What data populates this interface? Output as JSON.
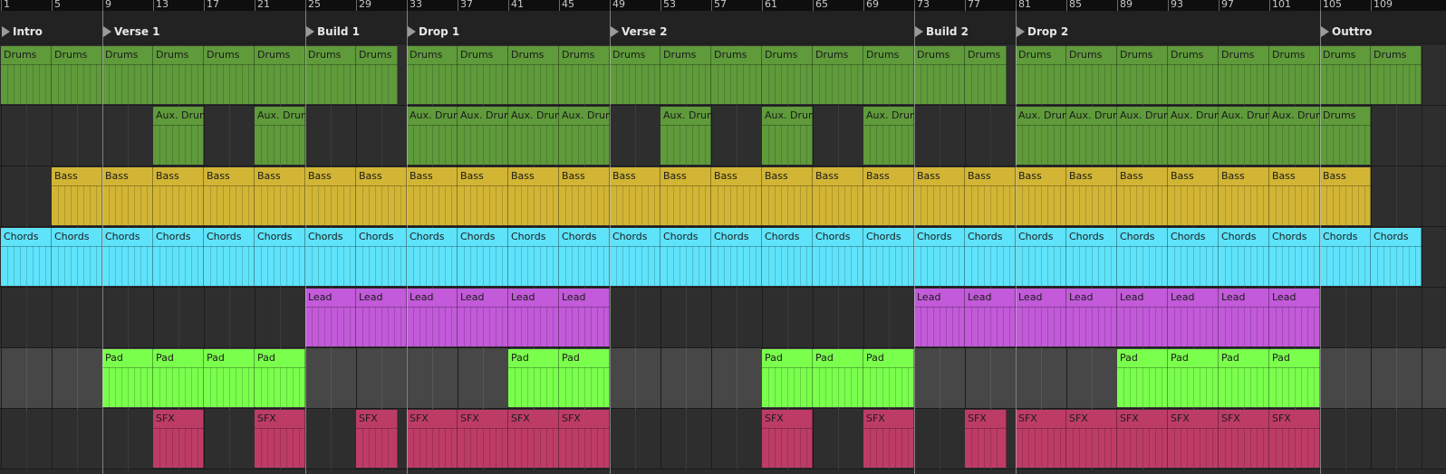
{
  "ruler": {
    "bar_numbers": [
      "1",
      "5",
      "9",
      "13",
      "17",
      "21",
      "25",
      "29",
      "33",
      "37",
      "41",
      "45",
      "49",
      "53",
      "57",
      "61",
      "65",
      "69",
      "73",
      "77",
      "81",
      "85",
      "89",
      "93",
      "97",
      "101",
      "105",
      "109"
    ]
  },
  "locators": [
    {
      "name": "Intro",
      "bar": 1
    },
    {
      "name": "Verse 1",
      "bar": 9
    },
    {
      "name": "Build 1",
      "bar": 25
    },
    {
      "name": "Drop 1",
      "bar": 33
    },
    {
      "name": "Verse 2",
      "bar": 49
    },
    {
      "name": "Build 2",
      "bar": 73
    },
    {
      "name": "Drop 2",
      "bar": 81
    },
    {
      "name": "Outtro",
      "bar": 105
    }
  ],
  "colors": {
    "drums": "#5f9a3b",
    "aux": "#5f9a3b",
    "bass": "#d2b535",
    "chords": "#5ee3fa",
    "lead": "#c25ad9",
    "pad": "#7aff4d",
    "sfx": "#bd3c66",
    "lane_dark": "#2e2e2e",
    "lane_light": "#474747",
    "grid_dark": "#3b3b3b",
    "grid_light": "#565656"
  },
  "tracks": [
    {
      "id": "drums",
      "shade": "dark",
      "clips": [
        {
          "name": "Drums",
          "bar": 1,
          "len": 4
        },
        {
          "name": "Drums",
          "bar": 5,
          "len": 4
        },
        {
          "name": "Drums",
          "bar": 9,
          "len": 4
        },
        {
          "name": "Drums",
          "bar": 13,
          "len": 4
        },
        {
          "name": "Drums",
          "bar": 17,
          "len": 4
        },
        {
          "name": "Drums",
          "bar": 21,
          "len": 4
        },
        {
          "name": "Drums",
          "bar": 25,
          "len": 4
        },
        {
          "name": "Drums",
          "bar": 29,
          "len": 3.25
        },
        {
          "name": "Drums",
          "bar": 33,
          "len": 4
        },
        {
          "name": "Drums",
          "bar": 37,
          "len": 4
        },
        {
          "name": "Drums",
          "bar": 41,
          "len": 4
        },
        {
          "name": "Drums",
          "bar": 45,
          "len": 4
        },
        {
          "name": "Drums",
          "bar": 49,
          "len": 4
        },
        {
          "name": "Drums",
          "bar": 53,
          "len": 4
        },
        {
          "name": "Drums",
          "bar": 57,
          "len": 4
        },
        {
          "name": "Drums",
          "bar": 61,
          "len": 4
        },
        {
          "name": "Drums",
          "bar": 65,
          "len": 4
        },
        {
          "name": "Drums",
          "bar": 69,
          "len": 4
        },
        {
          "name": "Drums",
          "bar": 73,
          "len": 4
        },
        {
          "name": "Drums",
          "bar": 77,
          "len": 3.25
        },
        {
          "name": "Drums",
          "bar": 81,
          "len": 4
        },
        {
          "name": "Drums",
          "bar": 85,
          "len": 4
        },
        {
          "name": "Drums",
          "bar": 89,
          "len": 4
        },
        {
          "name": "Drums",
          "bar": 93,
          "len": 4
        },
        {
          "name": "Drums",
          "bar": 97,
          "len": 4
        },
        {
          "name": "Drums",
          "bar": 101,
          "len": 4
        },
        {
          "name": "Drums",
          "bar": 105,
          "len": 4
        },
        {
          "name": "Drums",
          "bar": 109,
          "len": 4
        }
      ]
    },
    {
      "id": "aux",
      "shade": "dark",
      "clips": [
        {
          "name": "Aux. Drums",
          "bar": 13,
          "len": 4
        },
        {
          "name": "Aux. Drums",
          "bar": 21,
          "len": 4
        },
        {
          "name": "Aux. Drums",
          "bar": 33,
          "len": 4
        },
        {
          "name": "Aux. Drums",
          "bar": 37,
          "len": 4
        },
        {
          "name": "Aux. Drums",
          "bar": 41,
          "len": 4
        },
        {
          "name": "Aux. Drums",
          "bar": 45,
          "len": 4
        },
        {
          "name": "Aux. Drums",
          "bar": 53,
          "len": 4
        },
        {
          "name": "Aux. Drums",
          "bar": 61,
          "len": 4
        },
        {
          "name": "Aux. Drums",
          "bar": 69,
          "len": 4
        },
        {
          "name": "Aux. Drums",
          "bar": 81,
          "len": 4
        },
        {
          "name": "Aux. Drums",
          "bar": 85,
          "len": 4
        },
        {
          "name": "Aux. Drums",
          "bar": 89,
          "len": 4
        },
        {
          "name": "Aux. Drums",
          "bar": 93,
          "len": 4
        },
        {
          "name": "Aux. Drums",
          "bar": 97,
          "len": 4
        },
        {
          "name": "Aux. Drums",
          "bar": 101,
          "len": 4
        },
        {
          "name": "Drums",
          "bar": 105,
          "len": 4
        }
      ]
    },
    {
      "id": "bass",
      "shade": "dark",
      "clips": [
        {
          "name": "Bass",
          "bar": 5,
          "len": 4
        },
        {
          "name": "Bass",
          "bar": 9,
          "len": 4
        },
        {
          "name": "Bass",
          "bar": 13,
          "len": 4
        },
        {
          "name": "Bass",
          "bar": 17,
          "len": 4
        },
        {
          "name": "Bass",
          "bar": 21,
          "len": 4
        },
        {
          "name": "Bass",
          "bar": 25,
          "len": 4
        },
        {
          "name": "Bass",
          "bar": 29,
          "len": 4
        },
        {
          "name": "Bass",
          "bar": 33,
          "len": 4
        },
        {
          "name": "Bass",
          "bar": 37,
          "len": 4
        },
        {
          "name": "Bass",
          "bar": 41,
          "len": 4
        },
        {
          "name": "Bass",
          "bar": 45,
          "len": 4
        },
        {
          "name": "Bass",
          "bar": 49,
          "len": 4
        },
        {
          "name": "Bass",
          "bar": 53,
          "len": 4
        },
        {
          "name": "Bass",
          "bar": 57,
          "len": 4
        },
        {
          "name": "Bass",
          "bar": 61,
          "len": 4
        },
        {
          "name": "Bass",
          "bar": 65,
          "len": 4
        },
        {
          "name": "Bass",
          "bar": 69,
          "len": 4
        },
        {
          "name": "Bass",
          "bar": 73,
          "len": 4
        },
        {
          "name": "Bass",
          "bar": 77,
          "len": 4
        },
        {
          "name": "Bass",
          "bar": 81,
          "len": 4
        },
        {
          "name": "Bass",
          "bar": 85,
          "len": 4
        },
        {
          "name": "Bass",
          "bar": 89,
          "len": 4
        },
        {
          "name": "Bass",
          "bar": 93,
          "len": 4
        },
        {
          "name": "Bass",
          "bar": 97,
          "len": 4
        },
        {
          "name": "Bass",
          "bar": 101,
          "len": 4
        },
        {
          "name": "Bass",
          "bar": 105,
          "len": 4
        }
      ]
    },
    {
      "id": "chords",
      "shade": "dark",
      "clips": [
        {
          "name": "Chords",
          "bar": 1,
          "len": 4
        },
        {
          "name": "Chords",
          "bar": 5,
          "len": 4
        },
        {
          "name": "Chords",
          "bar": 9,
          "len": 4
        },
        {
          "name": "Chords",
          "bar": 13,
          "len": 4
        },
        {
          "name": "Chords",
          "bar": 17,
          "len": 4
        },
        {
          "name": "Chords",
          "bar": 21,
          "len": 4
        },
        {
          "name": "Chords",
          "bar": 25,
          "len": 4
        },
        {
          "name": "Chords",
          "bar": 29,
          "len": 4
        },
        {
          "name": "Chords",
          "bar": 33,
          "len": 4
        },
        {
          "name": "Chords",
          "bar": 37,
          "len": 4
        },
        {
          "name": "Chords",
          "bar": 41,
          "len": 4
        },
        {
          "name": "Chords",
          "bar": 45,
          "len": 4
        },
        {
          "name": "Chords",
          "bar": 49,
          "len": 4
        },
        {
          "name": "Chords",
          "bar": 53,
          "len": 4
        },
        {
          "name": "Chords",
          "bar": 57,
          "len": 4
        },
        {
          "name": "Chords",
          "bar": 61,
          "len": 4
        },
        {
          "name": "Chords",
          "bar": 65,
          "len": 4
        },
        {
          "name": "Chords",
          "bar": 69,
          "len": 4
        },
        {
          "name": "Chords",
          "bar": 73,
          "len": 4
        },
        {
          "name": "Chords",
          "bar": 77,
          "len": 4
        },
        {
          "name": "Chords",
          "bar": 81,
          "len": 4
        },
        {
          "name": "Chords",
          "bar": 85,
          "len": 4
        },
        {
          "name": "Chords",
          "bar": 89,
          "len": 4
        },
        {
          "name": "Chords",
          "bar": 93,
          "len": 4
        },
        {
          "name": "Chords",
          "bar": 97,
          "len": 4
        },
        {
          "name": "Chords",
          "bar": 101,
          "len": 4
        },
        {
          "name": "Chords",
          "bar": 105,
          "len": 4
        },
        {
          "name": "Chords",
          "bar": 109,
          "len": 4
        }
      ]
    },
    {
      "id": "lead",
      "shade": "dark",
      "clips": [
        {
          "name": "Lead",
          "bar": 25,
          "len": 4
        },
        {
          "name": "Lead",
          "bar": 29,
          "len": 4
        },
        {
          "name": "Lead",
          "bar": 33,
          "len": 4
        },
        {
          "name": "Lead",
          "bar": 37,
          "len": 4
        },
        {
          "name": "Lead",
          "bar": 41,
          "len": 4
        },
        {
          "name": "Lead",
          "bar": 45,
          "len": 4
        },
        {
          "name": "Lead",
          "bar": 73,
          "len": 4
        },
        {
          "name": "Lead",
          "bar": 77,
          "len": 4
        },
        {
          "name": "Lead",
          "bar": 81,
          "len": 4
        },
        {
          "name": "Lead",
          "bar": 85,
          "len": 4
        },
        {
          "name": "Lead",
          "bar": 89,
          "len": 4
        },
        {
          "name": "Lead",
          "bar": 93,
          "len": 4
        },
        {
          "name": "Lead",
          "bar": 97,
          "len": 4
        },
        {
          "name": "Lead",
          "bar": 101,
          "len": 4
        }
      ]
    },
    {
      "id": "pad",
      "shade": "light",
      "clips": [
        {
          "name": "Pad",
          "bar": 9,
          "len": 4
        },
        {
          "name": "Pad",
          "bar": 13,
          "len": 4
        },
        {
          "name": "Pad",
          "bar": 17,
          "len": 4
        },
        {
          "name": "Pad",
          "bar": 21,
          "len": 4
        },
        {
          "name": "Pad",
          "bar": 41,
          "len": 4
        },
        {
          "name": "Pad",
          "bar": 45,
          "len": 4
        },
        {
          "name": "Pad",
          "bar": 61,
          "len": 4
        },
        {
          "name": "Pad",
          "bar": 65,
          "len": 4
        },
        {
          "name": "Pad",
          "bar": 69,
          "len": 4
        },
        {
          "name": "Pad",
          "bar": 89,
          "len": 4
        },
        {
          "name": "Pad",
          "bar": 93,
          "len": 4
        },
        {
          "name": "Pad",
          "bar": 97,
          "len": 4
        },
        {
          "name": "Pad",
          "bar": 101,
          "len": 4
        }
      ]
    },
    {
      "id": "sfx",
      "shade": "dark",
      "clips": [
        {
          "name": "SFX",
          "bar": 13,
          "len": 4
        },
        {
          "name": "SFX",
          "bar": 21,
          "len": 4
        },
        {
          "name": "SFX",
          "bar": 29,
          "len": 3.25
        },
        {
          "name": "SFX",
          "bar": 33,
          "len": 4
        },
        {
          "name": "SFX",
          "bar": 37,
          "len": 4
        },
        {
          "name": "SFX",
          "bar": 41,
          "len": 4
        },
        {
          "name": "SFX",
          "bar": 45,
          "len": 4
        },
        {
          "name": "SFX",
          "bar": 61,
          "len": 4
        },
        {
          "name": "SFX",
          "bar": 69,
          "len": 4
        },
        {
          "name": "SFX",
          "bar": 77,
          "len": 3.25
        },
        {
          "name": "SFX",
          "bar": 81,
          "len": 4
        },
        {
          "name": "SFX",
          "bar": 85,
          "len": 4
        },
        {
          "name": "SFX",
          "bar": 89,
          "len": 4
        },
        {
          "name": "SFX",
          "bar": 93,
          "len": 4
        },
        {
          "name": "SFX",
          "bar": 97,
          "len": 4
        },
        {
          "name": "SFX",
          "bar": 101,
          "len": 4
        }
      ]
    }
  ]
}
